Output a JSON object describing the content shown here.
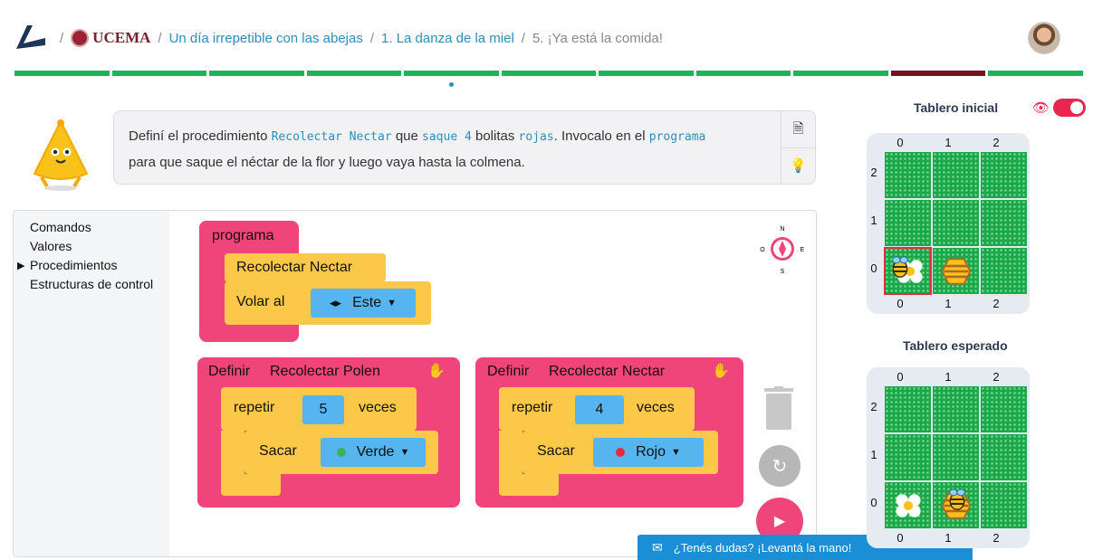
{
  "breadcrumb": {
    "org": "UCEMA",
    "items": [
      "Un día irrepetible con las abejas",
      "1. La danza de la miel"
    ],
    "current": "5. ¡Ya está la comida!"
  },
  "progress": {
    "segments": 11,
    "current_index": 9
  },
  "instructions": {
    "p1": "Definí el procedimiento",
    "c1": "Recolectar Nectar",
    "p2": "que",
    "c2": "saque 4",
    "p3": "bolitas",
    "c3": "rojas",
    "p4": ". Invocalo en el",
    "c4": "programa",
    "p5": "para que saque el néctar de la flor y luego vaya hasta la colmena."
  },
  "toolbox": {
    "categories": [
      "Comandos",
      "Valores",
      "Procedimientos",
      "Estructuras de control"
    ],
    "open_index": 2
  },
  "blocks": {
    "program": {
      "title": "programa",
      "call": "Recolectar Nectar",
      "move_label": "Volar al",
      "direction_icon": "◂▸",
      "direction": "Este"
    },
    "def1": {
      "define": "Definir",
      "name": "Recolectar Polen",
      "repeat": "repetir",
      "count": "5",
      "times": "veces",
      "action": "Sacar",
      "color": "Verde",
      "color_hex": "#3cb35a"
    },
    "def2": {
      "define": "Definir",
      "name": "Recolectar Nectar",
      "repeat": "repetir",
      "count": "4",
      "times": "veces",
      "action": "Sacar",
      "color": "Rojo",
      "color_hex": "#e8263c"
    }
  },
  "compass": {
    "n": "N",
    "s": "S",
    "e": "E",
    "o": "O"
  },
  "boards": {
    "initial_title": "Tablero inicial",
    "expected_title": "Tablero esperado",
    "cols": [
      "0",
      "1",
      "2"
    ],
    "rows": [
      "2",
      "1",
      "0"
    ]
  },
  "help": {
    "text": "¿Tenés dudas? ¡Levantá la mano!",
    "minimize": "−"
  },
  "colors": {
    "accent_pink": "#f0457a",
    "block_yellow": "#fbc84a",
    "input_blue": "#56b4ef",
    "progress_green": "#1bb35c",
    "link_blue": "#2a8fbd"
  }
}
